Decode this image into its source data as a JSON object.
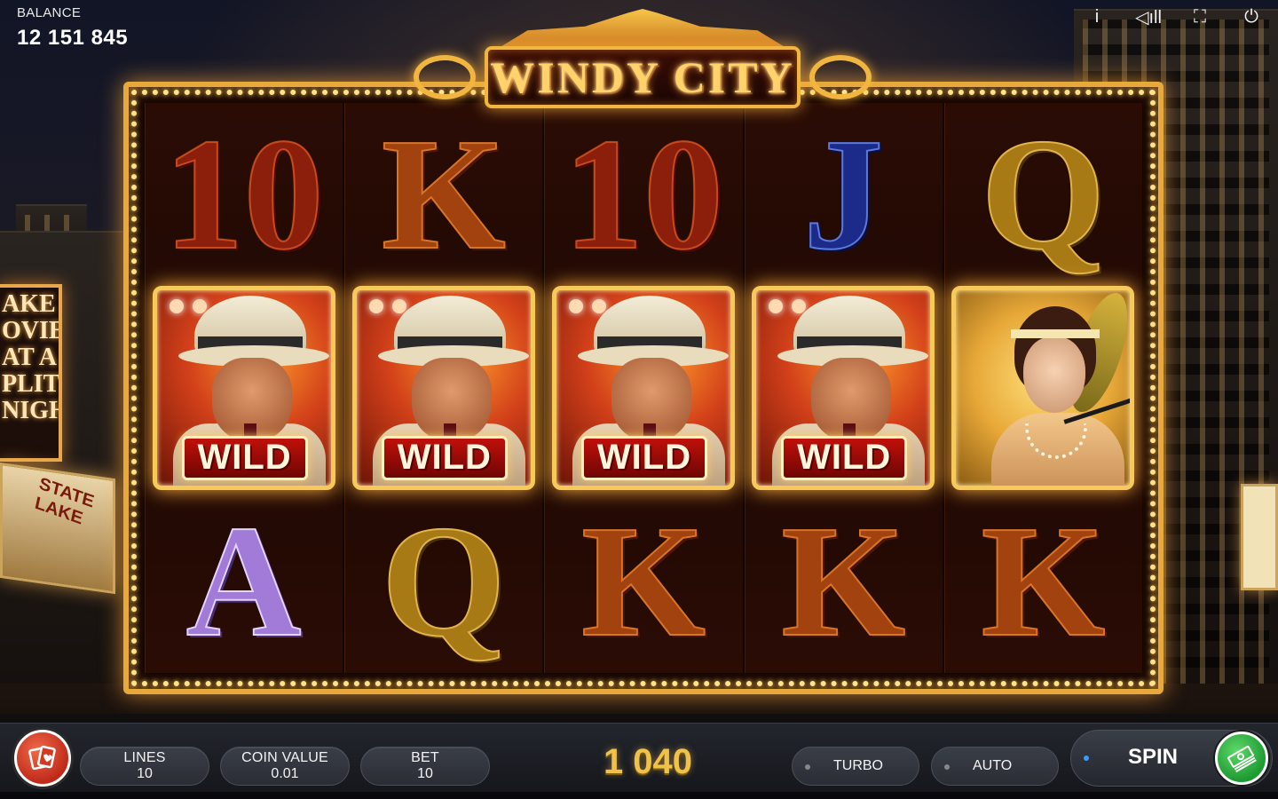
{
  "balance": {
    "label": "BALANCE",
    "value": "12 151 845"
  },
  "top_icons": [
    {
      "name": "info-icon",
      "glyph": "i"
    },
    {
      "name": "sound-icon",
      "glyph": "◁ıll"
    },
    {
      "name": "fullscreen-icon",
      "glyph": "⛶"
    },
    {
      "name": "power-icon",
      "glyph": "⏻"
    }
  ],
  "logo": {
    "title": "WINDY CITY"
  },
  "background_signs": {
    "left_sign": "AKE OVIES AT A PLITT NIGHT!",
    "marquee": "STATE LAKE"
  },
  "reels": [
    {
      "top": "10",
      "mid": "WILD",
      "bottom": "A"
    },
    {
      "top": "K",
      "mid": "WILD",
      "bottom": "Q"
    },
    {
      "top": "10",
      "mid": "WILD",
      "bottom": "K"
    },
    {
      "top": "J",
      "mid": "WILD",
      "bottom": "K"
    },
    {
      "top": "Q",
      "mid": "lady",
      "bottom": "K"
    }
  ],
  "wild_label": "WILD",
  "controls": {
    "lines": {
      "label": "LINES",
      "value": "10"
    },
    "coin_value": {
      "label": "COIN VALUE",
      "value": "0.01"
    },
    "bet": {
      "label": "BET",
      "value": "10"
    },
    "win": "1 040",
    "turbo": "TURBO",
    "auto": "AUTO",
    "spin": "SPIN"
  },
  "colors": {
    "frame_gold": "#e7a93c",
    "spin_green": "#1e9a32",
    "cards_red": "#c02a1a",
    "win_gold": "#f1c24a"
  }
}
